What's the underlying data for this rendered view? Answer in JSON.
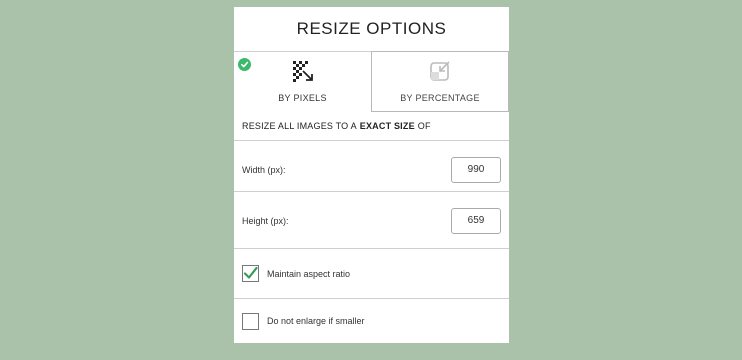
{
  "dialog": {
    "title": "RESIZE OPTIONS"
  },
  "tabs": [
    {
      "label": "BY PIXELS",
      "icon": "pixel-resize-icon",
      "selected": true
    },
    {
      "label": "BY PERCENTAGE",
      "icon": "percentage-resize-icon",
      "selected": false
    }
  ],
  "instruction": {
    "prefix": "RESIZE ALL IMAGES TO A",
    "emphasis": "EXACT SIZE",
    "suffix": "OF"
  },
  "fields": {
    "width_label": "Width (px):",
    "width_value": "990",
    "height_label": "Height (px):",
    "height_value": "659"
  },
  "options": {
    "maintain_label": "Maintain aspect ratio",
    "maintain_checked": true,
    "enlarge_label": "Do not enlarge if smaller",
    "enlarge_checked": false
  },
  "colors": {
    "background": "#a9c2a9",
    "selected_badge": "#3cb96b",
    "checkmark": "#3a9a55"
  }
}
